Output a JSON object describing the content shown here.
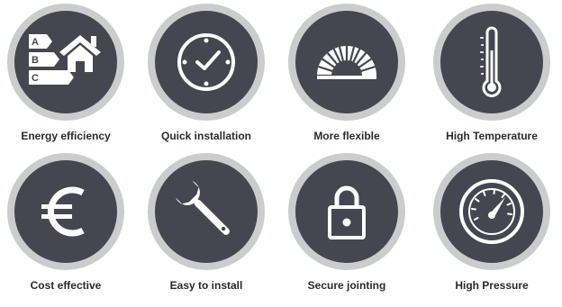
{
  "features": [
    {
      "label": "Energy efficiency",
      "icon": "energy-rating-house-icon"
    },
    {
      "label": "Quick installation",
      "icon": "clock-icon"
    },
    {
      "label": "More flexible",
      "icon": "flexible-fan-icon"
    },
    {
      "label": "High Temperature",
      "icon": "thermometer-icon"
    },
    {
      "label": "Cost effective",
      "icon": "euro-icon"
    },
    {
      "label": "Easy to install",
      "icon": "wrench-icon"
    },
    {
      "label": "Secure jointing",
      "icon": "padlock-icon"
    },
    {
      "label": "High Pressure",
      "icon": "pressure-gauge-icon"
    }
  ],
  "energy_rating_letters": [
    "A",
    "B",
    "C"
  ],
  "colors": {
    "badge_outer": "#c9cdcc",
    "badge_inner": "#45464f",
    "icon": "#ffffff",
    "label_text": "#2b2b2b"
  }
}
